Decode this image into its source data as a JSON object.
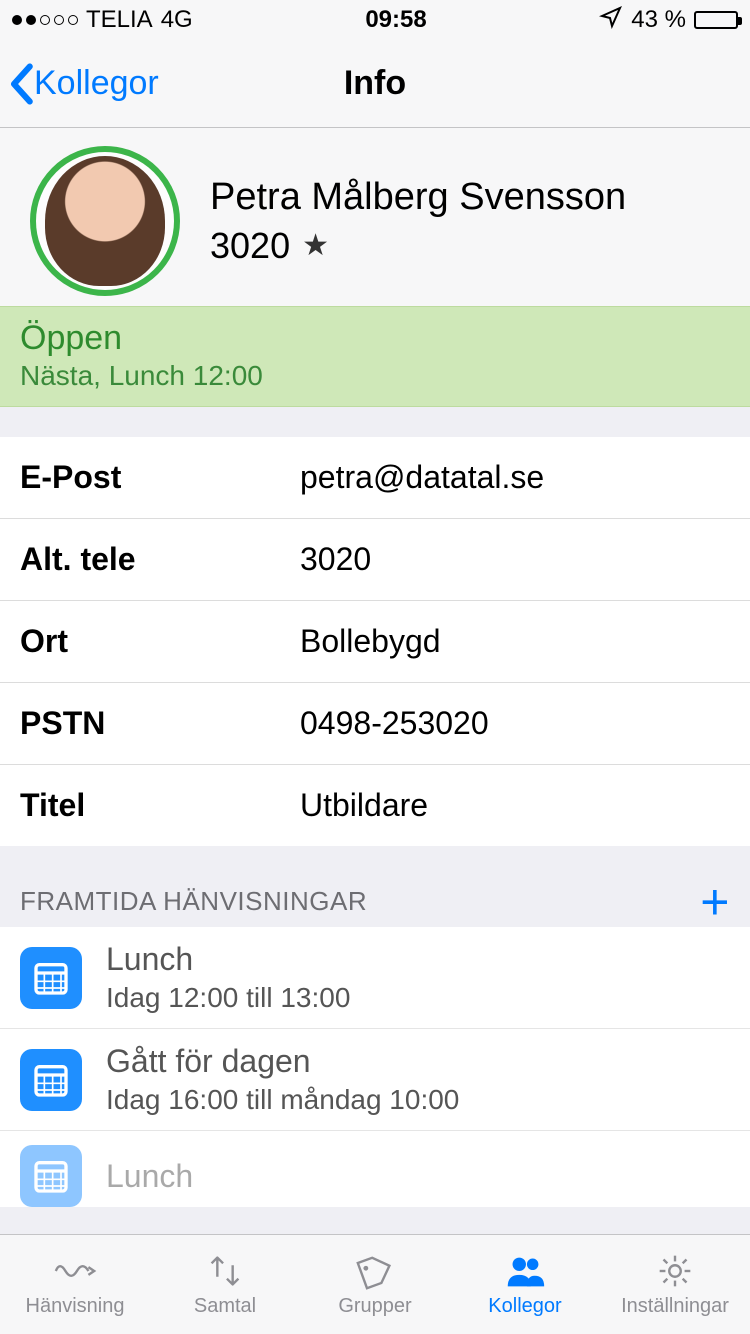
{
  "status_bar": {
    "carrier": "TELIA",
    "network": "4G",
    "time": "09:58",
    "battery_pct": "43 %"
  },
  "nav": {
    "back_label": "Kollegor",
    "title": "Info"
  },
  "profile": {
    "name": "Petra Målberg Svensson",
    "ext": "3020"
  },
  "status": {
    "title": "Öppen",
    "sub": "Nästa, Lunch 12:00"
  },
  "details": [
    {
      "label": "E-Post",
      "value": "petra@datatal.se"
    },
    {
      "label": "Alt. tele",
      "value": "3020"
    },
    {
      "label": "Ort",
      "value": "Bollebygd"
    },
    {
      "label": "PSTN",
      "value": "0498-253020"
    },
    {
      "label": "Titel",
      "value": "Utbildare"
    }
  ],
  "future": {
    "header": "FRAMTIDA HÄNVISNINGAR",
    "items": [
      {
        "title": "Lunch",
        "sub": "Idag 12:00 till 13:00"
      },
      {
        "title": "Gått för dagen",
        "sub": "Idag 16:00 till måndag 10:00"
      },
      {
        "title": "Lunch",
        "sub": ""
      }
    ]
  },
  "tabs": {
    "t0": "Hänvisning",
    "t1": "Samtal",
    "t2": "Grupper",
    "t3": "Kollegor",
    "t4": "Inställningar"
  }
}
